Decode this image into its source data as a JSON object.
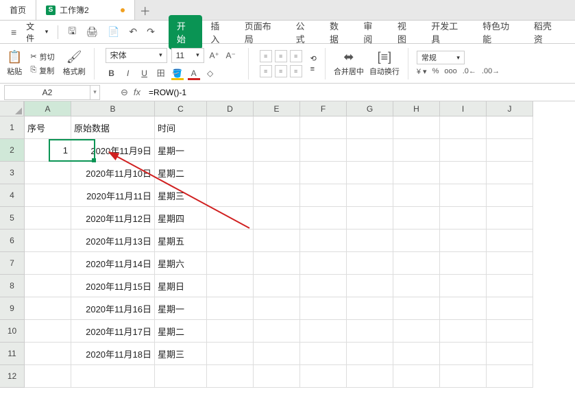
{
  "tabs": {
    "home": "首页",
    "doc": "工作簿2"
  },
  "menu": {
    "file": "文件",
    "items": [
      "开始",
      "插入",
      "页面布局",
      "公式",
      "数据",
      "审阅",
      "视图",
      "开发工具",
      "特色功能",
      "稻壳资"
    ]
  },
  "ribbon": {
    "paste": "粘贴",
    "cut": "剪切",
    "copy": "复制",
    "brush": "格式刷",
    "font": "宋体",
    "size": "11",
    "merge": "合并居中",
    "wrap": "自动换行",
    "numfmt": "常规"
  },
  "formula": {
    "name": "A2",
    "fx": "fx",
    "value": "=ROW()-1"
  },
  "cols": [
    "A",
    "B",
    "C",
    "D",
    "E",
    "F",
    "G",
    "H",
    "I",
    "J"
  ],
  "headers": {
    "A": "序号",
    "B": "原始数据",
    "C": "时间"
  },
  "a2": "1",
  "rows": [
    {
      "b": "2020年11月9日",
      "c": "星期一"
    },
    {
      "b": "2020年11月10日",
      "c": "星期二"
    },
    {
      "b": "2020年11月11日",
      "c": "星期三"
    },
    {
      "b": "2020年11月12日",
      "c": "星期四"
    },
    {
      "b": "2020年11月13日",
      "c": "星期五"
    },
    {
      "b": "2020年11月14日",
      "c": "星期六"
    },
    {
      "b": "2020年11月15日",
      "c": "星期日"
    },
    {
      "b": "2020年11月16日",
      "c": "星期一"
    },
    {
      "b": "2020年11月17日",
      "c": "星期二"
    },
    {
      "b": "2020年11月18日",
      "c": "星期三"
    }
  ]
}
